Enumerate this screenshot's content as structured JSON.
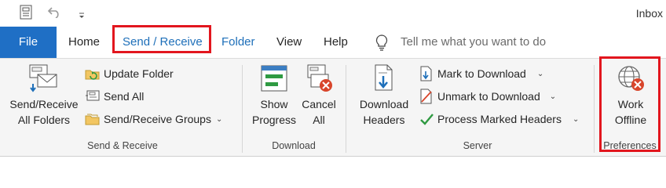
{
  "title_bar": {
    "title": "Inbox"
  },
  "tabs": [
    {
      "label": "File"
    },
    {
      "label": "Home"
    },
    {
      "label": "Send / Receive"
    },
    {
      "label": "Folder"
    },
    {
      "label": "View"
    },
    {
      "label": "Help"
    }
  ],
  "tell_me": {
    "text": "Tell me what you want to do"
  },
  "ribbon": {
    "send_receive_group": {
      "label": "Send & Receive",
      "send_receive_all_line1": "Send/Receive",
      "send_receive_all_line2": "All Folders",
      "update_folder": "Update Folder",
      "send_all": "Send All",
      "send_receive_groups": "Send/Receive Groups"
    },
    "download_group": {
      "label": "Download",
      "show_progress_line1": "Show",
      "show_progress_line2": "Progress",
      "cancel_all_line1": "Cancel",
      "cancel_all_line2": "All"
    },
    "server_group": {
      "label": "Server",
      "download_headers_line1": "Download",
      "download_headers_line2": "Headers",
      "mark_to_download": "Mark to Download",
      "unmark_to_download": "Unmark to Download",
      "process_marked_headers": "Process Marked Headers"
    },
    "preferences_group": {
      "label": "Preferences",
      "work_offline_line1": "Work",
      "work_offline_line2": "Offline"
    }
  },
  "colors": {
    "file_tab": "#1f6fc5",
    "active_tab_text": "#1e6fb9",
    "highlight_box": "#e2161e"
  }
}
